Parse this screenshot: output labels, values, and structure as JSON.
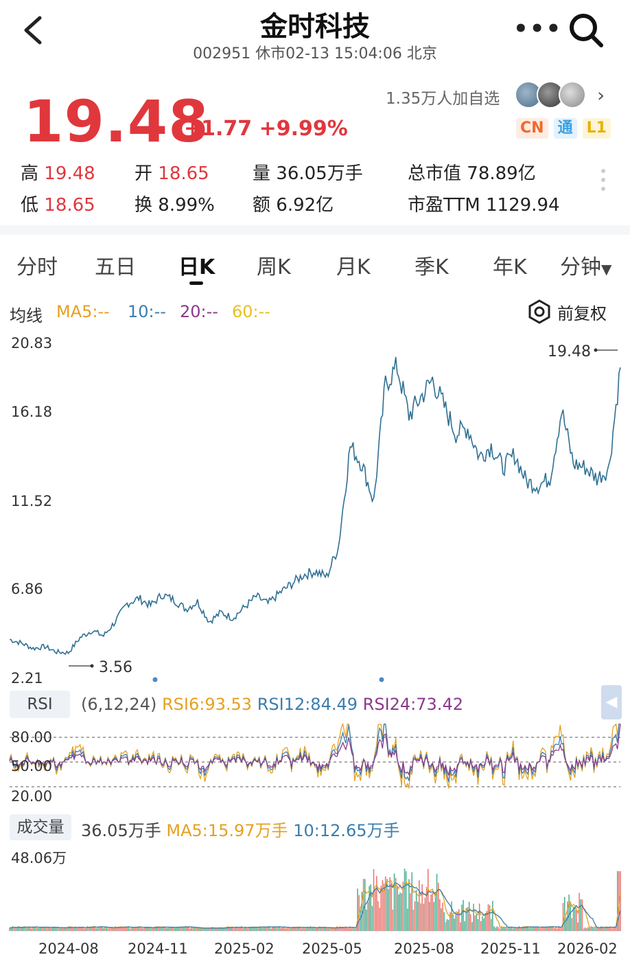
{
  "header": {
    "title": "金时科技",
    "subtitle": "002951 休市02-13 15:04:06 北京",
    "more_label": "•••"
  },
  "quote": {
    "price": "19.48",
    "change": "+1.77",
    "change_pct": "+9.99%",
    "watchers": "1.35万人加自选",
    "tags": [
      {
        "label": "CN",
        "color": "#f06a2a"
      },
      {
        "label": "通",
        "color": "#3aa0e0"
      },
      {
        "label": "L1",
        "color": "#e8b000"
      }
    ],
    "stats": {
      "high_label": "高",
      "high": "19.48",
      "open_label": "开",
      "open": "18.65",
      "volume_label": "量",
      "volume": "36.05万手",
      "mktcap_label": "总市值",
      "mktcap": "78.89亿",
      "low_label": "低",
      "low": "18.65",
      "turnover_label": "换",
      "turnover": "8.99%",
      "amount_label": "额",
      "amount": "6.92亿",
      "pe_label": "市盈TTM",
      "pe": "1129.94"
    }
  },
  "tabs": [
    "分时",
    "五日",
    "日K",
    "周K",
    "月K",
    "季K",
    "年K",
    "分钟"
  ],
  "active_tab": "日K",
  "ma": {
    "label": "均线",
    "ma5": "MA5:--",
    "ma10": "10:--",
    "ma20": "20:--",
    "ma60": "60:--",
    "adjust": "前复权"
  },
  "colors": {
    "up": "#e0373d",
    "ma5": "#e6a020",
    "ma10": "#3b7dae",
    "ma20": "#8b3a8b",
    "ma60": "#e8c020",
    "price_line": "#2f6f93"
  },
  "rsi": {
    "label": "RSI",
    "params": "(6,12,24)",
    "rsi6": "RSI6:93.53",
    "rsi12": "RSI12:84.49",
    "rsi24": "RSI24:73.42",
    "levels": [
      "80.00",
      "50.00",
      "20.00"
    ]
  },
  "volume": {
    "label": "成交量",
    "current": "36.05万手",
    "ma5": "MA5:15.97万手",
    "ma10": "10:12.65万手",
    "max_label": "48.06万"
  },
  "chart_data": {
    "type": "line",
    "price_axis_ticks": [
      "20.83",
      "16.18",
      "11.52",
      "6.86",
      "2.21"
    ],
    "x_tick_labels": [
      "2024-08",
      "2024-11",
      "2025-02",
      "2025-05",
      "2025-08",
      "2025-11",
      "2026-02"
    ],
    "ylim": [
      2.21,
      20.83
    ],
    "max_annotation": "19.48",
    "min_annotation": "3.56",
    "price": [
      4.3,
      4.1,
      3.8,
      3.9,
      3.6,
      3.56,
      4.4,
      4.8,
      4.5,
      5.3,
      6.3,
      6.6,
      6.2,
      6.8,
      6.5,
      6.0,
      6.4,
      5.3,
      5.8,
      5.5,
      6.1,
      6.7,
      6.3,
      6.9,
      7.4,
      7.9,
      8.1,
      7.8,
      9.5,
      15.1,
      14.1,
      12.0,
      18.6,
      19.5,
      16.8,
      17.8,
      18.8,
      17.3,
      15.8,
      16.1,
      14.5,
      15.1,
      13.9,
      14.6,
      13.1,
      12.9,
      13.3,
      17.1,
      14.1,
      13.9,
      13.3,
      13.8,
      19.48
    ],
    "volume_series": {
      "name": "成交量",
      "unit": "万手",
      "max": 48.06
    }
  }
}
